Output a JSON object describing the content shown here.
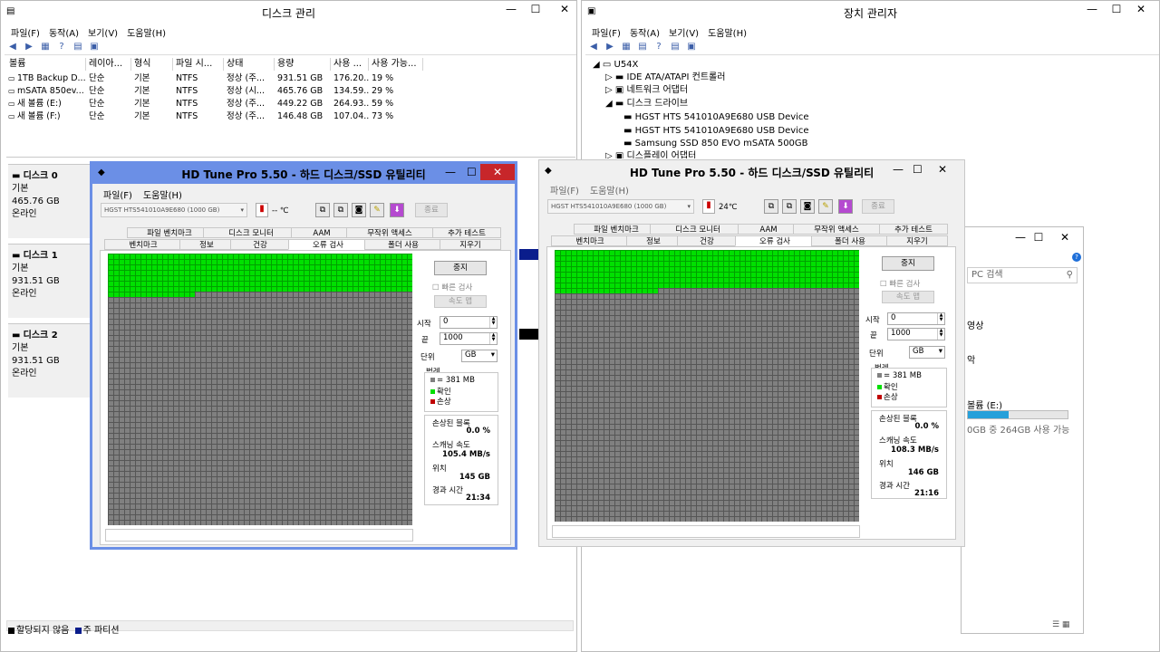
{
  "dm": {
    "title": "디스크 관리",
    "menu": [
      "파일(F)",
      "동작(A)",
      "보기(V)",
      "도움말(H)"
    ],
    "cols": [
      "볼륨",
      "레이아...",
      "형식",
      "파일 시...",
      "상태",
      "용량",
      "사용 ...",
      "사용 가능..."
    ],
    "rows": [
      [
        "1TB Backup D...",
        "단순",
        "기본",
        "NTFS",
        "정상 (주...",
        "931.51 GB",
        "176.20...",
        "19 %"
      ],
      [
        "mSATA 850ev...",
        "단순",
        "기본",
        "NTFS",
        "정상 (시...",
        "465.76 GB",
        "134.59...",
        "29 %"
      ],
      [
        "새 볼륨 (E:)",
        "단순",
        "기본",
        "NTFS",
        "정상 (주...",
        "449.22 GB",
        "264.93...",
        "59 %"
      ],
      [
        "새 볼륨 (F:)",
        "단순",
        "기본",
        "NTFS",
        "정상 (주...",
        "146.48 GB",
        "107.04...",
        "73 %"
      ]
    ],
    "disks": [
      {
        "name": "디스크 0",
        "type": "기본",
        "size": "465.76 GB",
        "status": "온라인"
      },
      {
        "name": "디스크 1",
        "type": "기본",
        "size": "931.51 GB",
        "status": "온라인"
      },
      {
        "name": "디스크 2",
        "type": "기본",
        "size": "931.51 GB",
        "status": "온라인"
      }
    ],
    "legend": [
      "할당되지 않음",
      "주 파티션"
    ]
  },
  "devm": {
    "title": "장치 관리자",
    "menu": [
      "파일(F)",
      "동작(A)",
      "보기(V)",
      "도움말(H)"
    ],
    "root": "U54X",
    "items": [
      "IDE ATA/ATAPI 컨트롤러",
      "네트워크 어댑터",
      "디스크 드라이브",
      "HGST HTS 541010A9E680 USB Device",
      "HGST HTS 541010A9E680 USB Device",
      "Samsung SSD 850 EVO mSATA 500GB",
      "디스플레이 어댑터"
    ]
  },
  "explorer": {
    "search": "PC 검색",
    "item1": "영상",
    "item2": "악",
    "vol_label": "볼륨 (E:)",
    "vol_info": "0GB 중 264GB 사용 가능",
    "vol_used_fraction": 0.41
  },
  "hd1": {
    "title": "HD Tune Pro 5.50 - 하드 디스크/SSD 유틸리티",
    "menu": [
      "파일(F)",
      "도움말(H)"
    ],
    "device": "HGST HTS541010A9E680 (1000 GB)",
    "temp": "-- ℃",
    "exit": "종료",
    "tabs_top": [
      "파일 벤치마크",
      "디스크 모니터",
      "AAM",
      "무작위 액세스",
      "추가 테스트"
    ],
    "tabs_bot": [
      "벤치마크",
      "정보",
      "건강",
      "오류 검사",
      "폴더 사용",
      "지우기"
    ],
    "stop": "중지",
    "quick": "빠른 검사",
    "speedmap": "속도 맵",
    "start_label": "시작",
    "start": "0",
    "end_label": "끝",
    "end": "1000",
    "unit_label": "단위",
    "unit": "GB",
    "legend_title": "범례",
    "legend": [
      "= 381 MB",
      "확인",
      "손상"
    ],
    "damaged_label": "손상된 블록",
    "damaged": "0.0 %",
    "speed_label": "스캐닝 속도",
    "speed": "105.4 MB/s",
    "pos_label": "위치",
    "pos": "145 GB",
    "elapsed_label": "경과 시간",
    "elapsed": "21:34"
  },
  "hd2": {
    "title": "HD Tune Pro 5.50 - 하드 디스크/SSD 유틸리티",
    "menu": [
      "파일(F)",
      "도움말(H)"
    ],
    "device": "HGST HTS541010A9E680 (1000 GB)",
    "temp": "24℃",
    "exit": "종료",
    "tabs_top": [
      "파일 벤치마크",
      "디스크 모니터",
      "AAM",
      "무작위 액세스",
      "추가 테스트"
    ],
    "tabs_bot": [
      "벤치마크",
      "정보",
      "건강",
      "오류 검사",
      "폴더 사용",
      "지우기"
    ],
    "stop": "중지",
    "quick": "빠른 검사",
    "speedmap": "속도 맵",
    "start_label": "시작",
    "start": "0",
    "end_label": "끝",
    "end": "1000",
    "unit_label": "단위",
    "unit": "GB",
    "legend_title": "범례",
    "legend": [
      "= 381 MB",
      "확인",
      "손상"
    ],
    "damaged_label": "손상된 블록",
    "damaged": "0.0 %",
    "speed_label": "스캐닝 속도",
    "speed": "108.3 MB/s",
    "pos_label": "위치",
    "pos": "146 GB",
    "elapsed_label": "경과 시간",
    "elapsed": "21:16"
  },
  "colors": {
    "ok": "#00e000",
    "damaged": "#c00000",
    "unscanned": "#808080",
    "accent": "#6b8fe6"
  }
}
